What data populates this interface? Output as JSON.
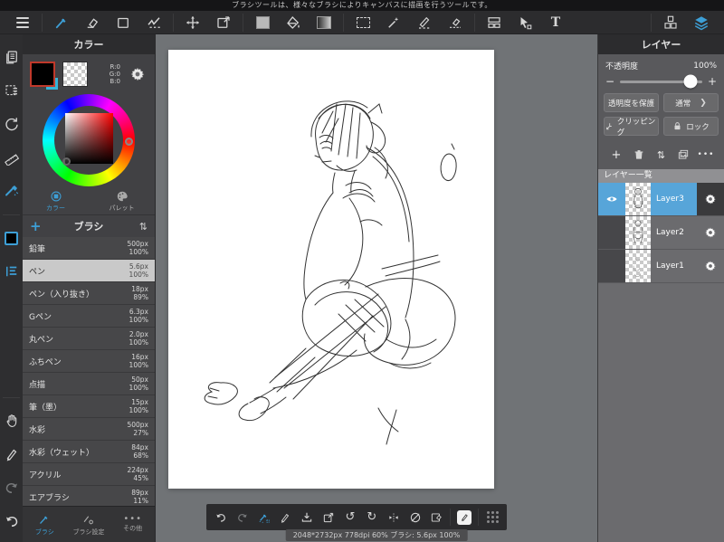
{
  "titlebar": {
    "text": "ブラシツールは、様々なブラシによりキャンバスに描画を行うツールです。"
  },
  "icons": {
    "text_tool": "T",
    "sort_arrows": "⇅",
    "plus": "+",
    "more_dots": "•••",
    "minus": "−",
    "plus_sign": "+",
    "chevron_right": "❯",
    "rotate_ccw": "↺",
    "rotate_cw": "↻"
  },
  "color_panel": {
    "title": "カラー",
    "rgb": {
      "r": "R:0",
      "g": "G:0",
      "b": "B:0"
    },
    "tabs": [
      {
        "label": "カラー"
      },
      {
        "label": "パレット"
      }
    ]
  },
  "brush_panel": {
    "title": "ブラシ",
    "brushes": [
      {
        "name": "鉛筆",
        "size": "500px",
        "opacity": "100%"
      },
      {
        "name": "ペン",
        "size": "5.6px",
        "opacity": "100%"
      },
      {
        "name": "ペン（入り抜き）",
        "size": "18px",
        "opacity": "89%"
      },
      {
        "name": "Gペン",
        "size": "6.3px",
        "opacity": "100%"
      },
      {
        "name": "丸ペン",
        "size": "2.0px",
        "opacity": "100%"
      },
      {
        "name": "ふちペン",
        "size": "16px",
        "opacity": "100%"
      },
      {
        "name": "点描",
        "size": "50px",
        "opacity": "100%"
      },
      {
        "name": "筆（墨）",
        "size": "15px",
        "opacity": "100%"
      },
      {
        "name": "水彩",
        "size": "500px",
        "opacity": "27%"
      },
      {
        "name": "水彩（ウェット）",
        "size": "84px",
        "opacity": "68%"
      },
      {
        "name": "アクリル",
        "size": "224px",
        "opacity": "45%"
      },
      {
        "name": "エアブラシ",
        "size": "89px",
        "opacity": "11%"
      }
    ]
  },
  "bottom_tabs": [
    {
      "label": "ブラシ"
    },
    {
      "label": "ブラシ設定"
    },
    {
      "label": "その他"
    }
  ],
  "layer_panel": {
    "title": "レイヤー",
    "opacity_label": "不透明度",
    "opacity_value": "100%",
    "protect_button": "透明度を保護",
    "blend_button": "通常",
    "clipping_button": "クリッピング",
    "lock_button": "ロック",
    "list_header": "レイヤー一覧",
    "layers": [
      {
        "name": "Layer3"
      },
      {
        "name": "Layer2"
      },
      {
        "name": "Layer1"
      }
    ]
  },
  "statusbar": {
    "text": "2048*2732px 778dpi 60% ブラシ: 5.6px 100%"
  }
}
